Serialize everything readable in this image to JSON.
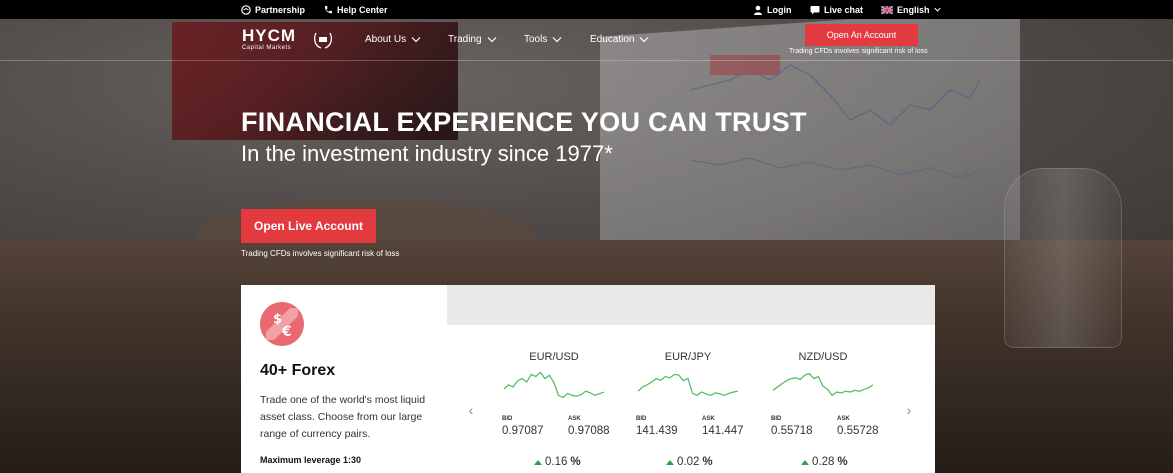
{
  "topbar": {
    "partnership": "Partnership",
    "help_center": "Help Center",
    "login": "Login",
    "live_chat": "Live chat",
    "language": "English"
  },
  "header": {
    "logo_main": "HYCM",
    "logo_sub": "Capital Markets",
    "nav": [
      "About Us",
      "Trading",
      "Tools",
      "Education"
    ],
    "cta": "Open An Account",
    "risk": "Trading CFDs involves significant risk of loss"
  },
  "hero": {
    "title": "FINANCIAL EXPERIENCE YOU CAN TRUST",
    "subtitle": "In the investment industry since 1977*",
    "cta": "Open Live Account",
    "risk": "Trading CFDs involves significant risk of loss"
  },
  "product": {
    "icon": "dollar-euro-icon",
    "title": "40+ Forex",
    "description": "Trade one of the world's most liquid asset class. Choose from our large range of currency pairs.",
    "leverage": "Maximum leverage 1:30"
  },
  "quotes": {
    "bid_label": "BID",
    "ask_label": "ASK",
    "pairs": [
      {
        "name": "EUR/USD",
        "bid": "0.97087",
        "ask": "0.97088",
        "change": "0.16",
        "pct": "%",
        "spark": [
          0.45,
          0.55,
          0.5,
          0.65,
          0.7,
          0.62,
          0.8,
          0.75,
          0.85,
          0.7,
          0.78,
          0.6,
          0.3,
          0.25,
          0.35,
          0.3,
          0.28,
          0.32,
          0.4,
          0.36,
          0.3,
          0.34,
          0.38
        ]
      },
      {
        "name": "EUR/JPY",
        "bid": "141.439",
        "ask": "141.447",
        "change": "0.02",
        "pct": "%",
        "spark": [
          0.4,
          0.5,
          0.55,
          0.62,
          0.7,
          0.66,
          0.75,
          0.72,
          0.8,
          0.78,
          0.65,
          0.7,
          0.35,
          0.3,
          0.38,
          0.33,
          0.3,
          0.36,
          0.34,
          0.3,
          0.35,
          0.38,
          0.4
        ]
      },
      {
        "name": "NZD/USD",
        "bid": "0.55718",
        "ask": "0.55728",
        "change": "0.28",
        "pct": "%",
        "spark": [
          0.42,
          0.5,
          0.58,
          0.65,
          0.7,
          0.72,
          0.68,
          0.78,
          0.82,
          0.7,
          0.75,
          0.52,
          0.45,
          0.3,
          0.38,
          0.36,
          0.4,
          0.38,
          0.42,
          0.4,
          0.44,
          0.48,
          0.55
        ]
      }
    ],
    "colors": {
      "up": "#2aa24a",
      "spark": "#4dbb5d"
    }
  },
  "colors": {
    "accent": "#e33a3f"
  }
}
